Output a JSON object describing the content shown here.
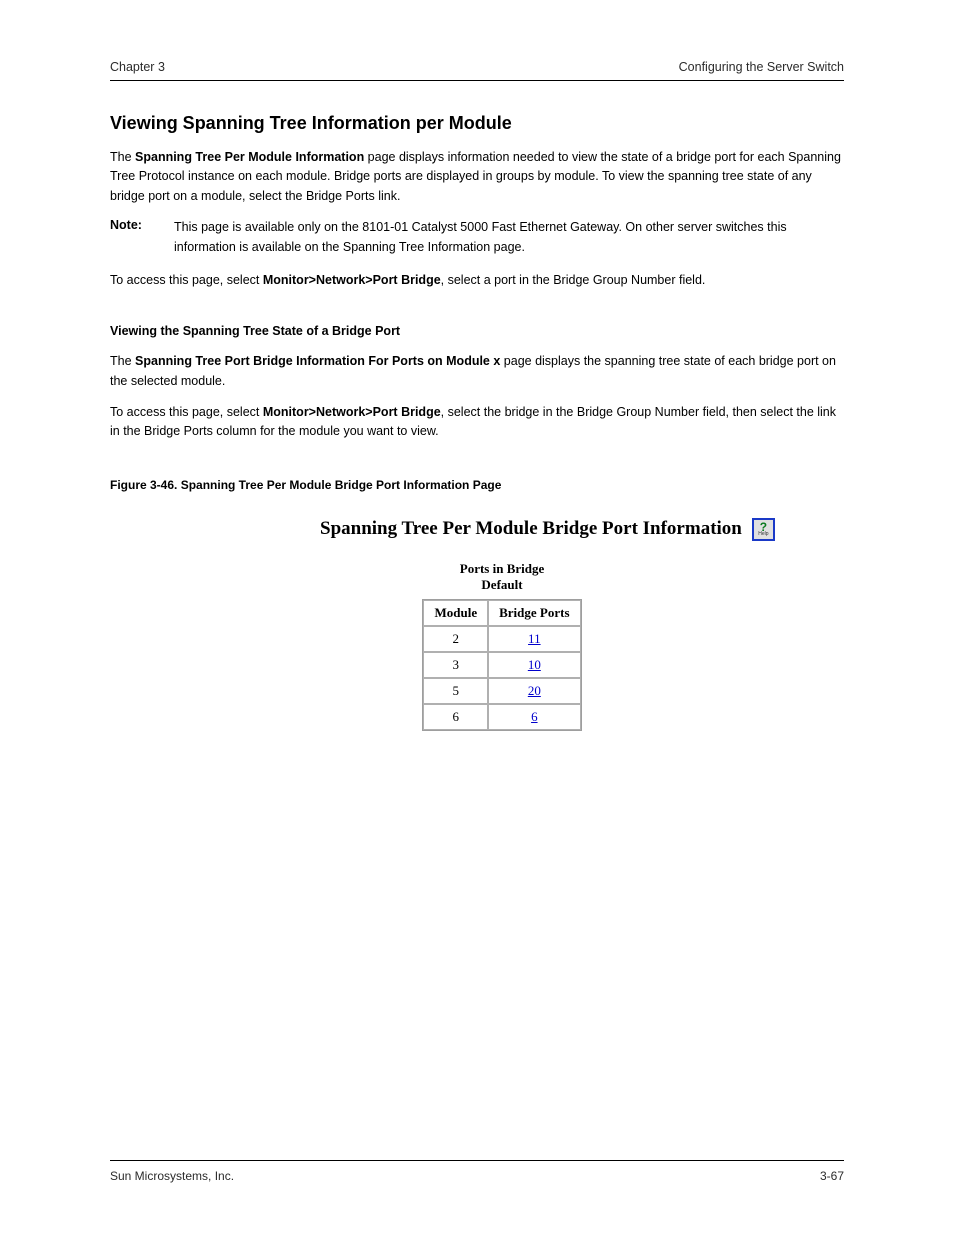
{
  "page": {
    "running_head_left": "Chapter 3",
    "running_head_right": "Configuring the Server Switch",
    "section_heading": "Viewing Spanning Tree Information per Module",
    "para1_a": "The ",
    "para1_b": "Spanning Tree Per Module Information",
    "para1_c": " page displays information needed to view the state of a bridge port for each Spanning Tree Protocol instance on each module. Bridge ports are displayed in groups by module. To view the spanning tree state of any bridge port on a module, select the Bridge Ports link.",
    "note_label": "Note:",
    "note_body_a": "This page is available only on the 8101-01 Catalyst 5000 Fast Ethernet Gateway. On other server switches this information is available on the ",
    "note_body_b": "Spanning Tree Information",
    "note_body_c": " page.",
    "para2_a": "To access this page, select ",
    "para2_b": "Monitor>Network>Port Bridge",
    "para2_c": ", select a port in the Bridge Group Number field.",
    "sub_heading": "Viewing the Spanning Tree State of a Bridge Port",
    "para3_a": "The ",
    "para3_b": "Spanning Tree Port Bridge Information For Ports on Module x",
    "para3_c": " page displays the spanning tree state of each bridge port on the selected module.",
    "para4_a": "To access this page, select ",
    "para4_b": "Monitor>Network>Port Bridge",
    "para4_c": ", select the bridge in the Bridge Group Number field, then select the link in the Bridge Ports column for the module you want to view.",
    "figure_caption": "Figure 3-46.   Spanning Tree Per Module Bridge Port Information Page",
    "figure": {
      "title": "Spanning Tree Per Module Bridge Port Information",
      "help_alt": "Help",
      "super_caption_line1": "Ports in Bridge",
      "super_caption_line2": "Default",
      "headers": {
        "module": "Module",
        "bridge_ports": "Bridge Ports"
      },
      "rows": [
        {
          "module": "2",
          "ports": "11"
        },
        {
          "module": "3",
          "ports": "10"
        },
        {
          "module": "5",
          "ports": "20"
        },
        {
          "module": "6",
          "ports": "6"
        }
      ]
    },
    "footer_left": "Sun Microsystems, Inc.",
    "footer_right": "3-67"
  }
}
